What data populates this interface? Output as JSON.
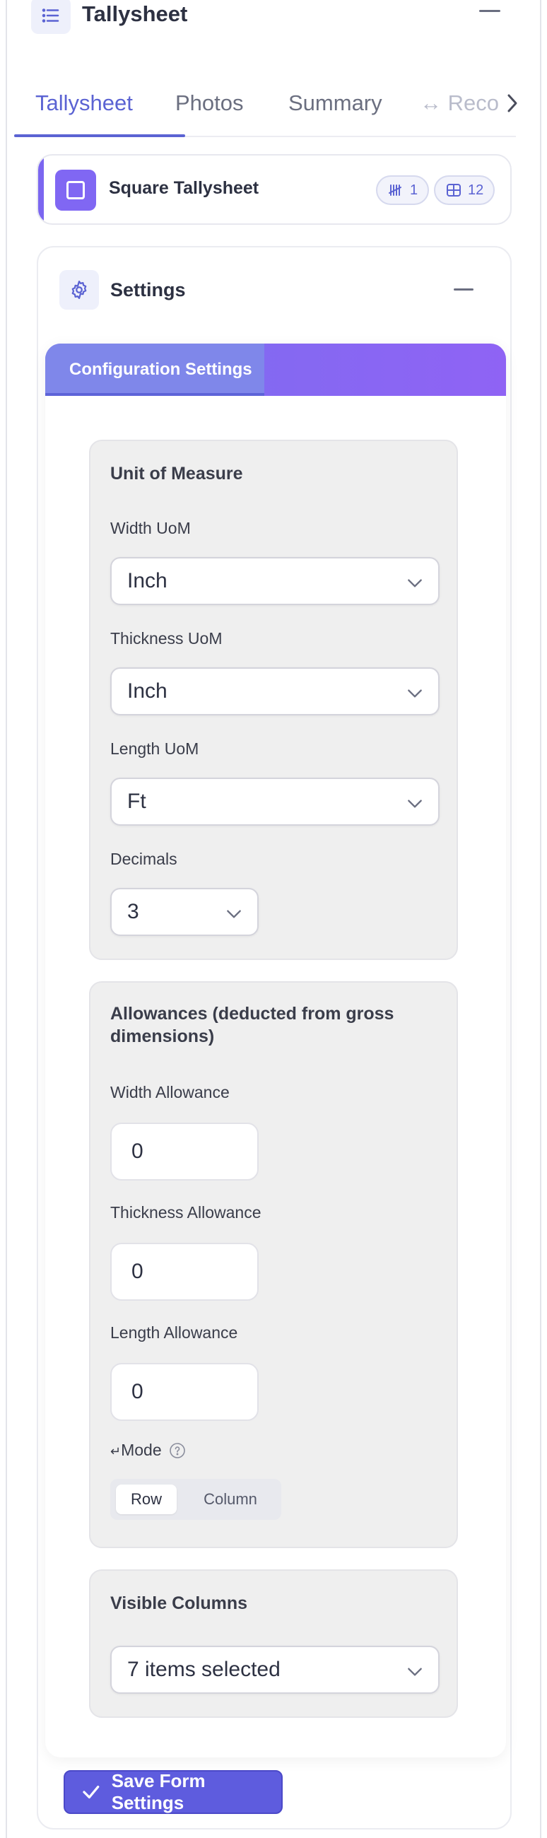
{
  "header": {
    "title": "Tallysheet"
  },
  "tabs": [
    {
      "label": "Tallysheet",
      "active": true
    },
    {
      "label": "Photos",
      "active": false
    },
    {
      "label": "Summary",
      "active": false
    },
    {
      "label": "↔ Reco",
      "active": false
    }
  ],
  "square_card": {
    "title": "Square Tallysheet",
    "tally_count": "1",
    "grid_count": "12"
  },
  "settings": {
    "title": "Settings",
    "config_tab": "Configuration Settings",
    "uom": {
      "title": "Unit of Measure",
      "width_label": "Width UoM",
      "width_value": "Inch",
      "thickness_label": "Thickness UoM",
      "thickness_value": "Inch",
      "length_label": "Length UoM",
      "length_value": "Ft",
      "decimals_label": "Decimals",
      "decimals_value": "3"
    },
    "allowances": {
      "title": "Allowances (deducted from gross dimensions)",
      "width_label": "Width Allowance",
      "width_value": "0",
      "thickness_label": "Thickness Allowance",
      "thickness_value": "0",
      "length_label": "Length Allowance",
      "length_value": "0",
      "mode_label": "Mode",
      "mode_prefix": "↵",
      "mode_options": [
        "Row",
        "Column"
      ],
      "mode_selected": "Row"
    },
    "visible_columns": {
      "title": "Visible Columns",
      "value": "7 items selected"
    },
    "save_label": "Save Form Settings"
  },
  "colors": {
    "accent": "#5b63d3",
    "purple": "#8067f3",
    "save_button": "#5e5cde"
  }
}
